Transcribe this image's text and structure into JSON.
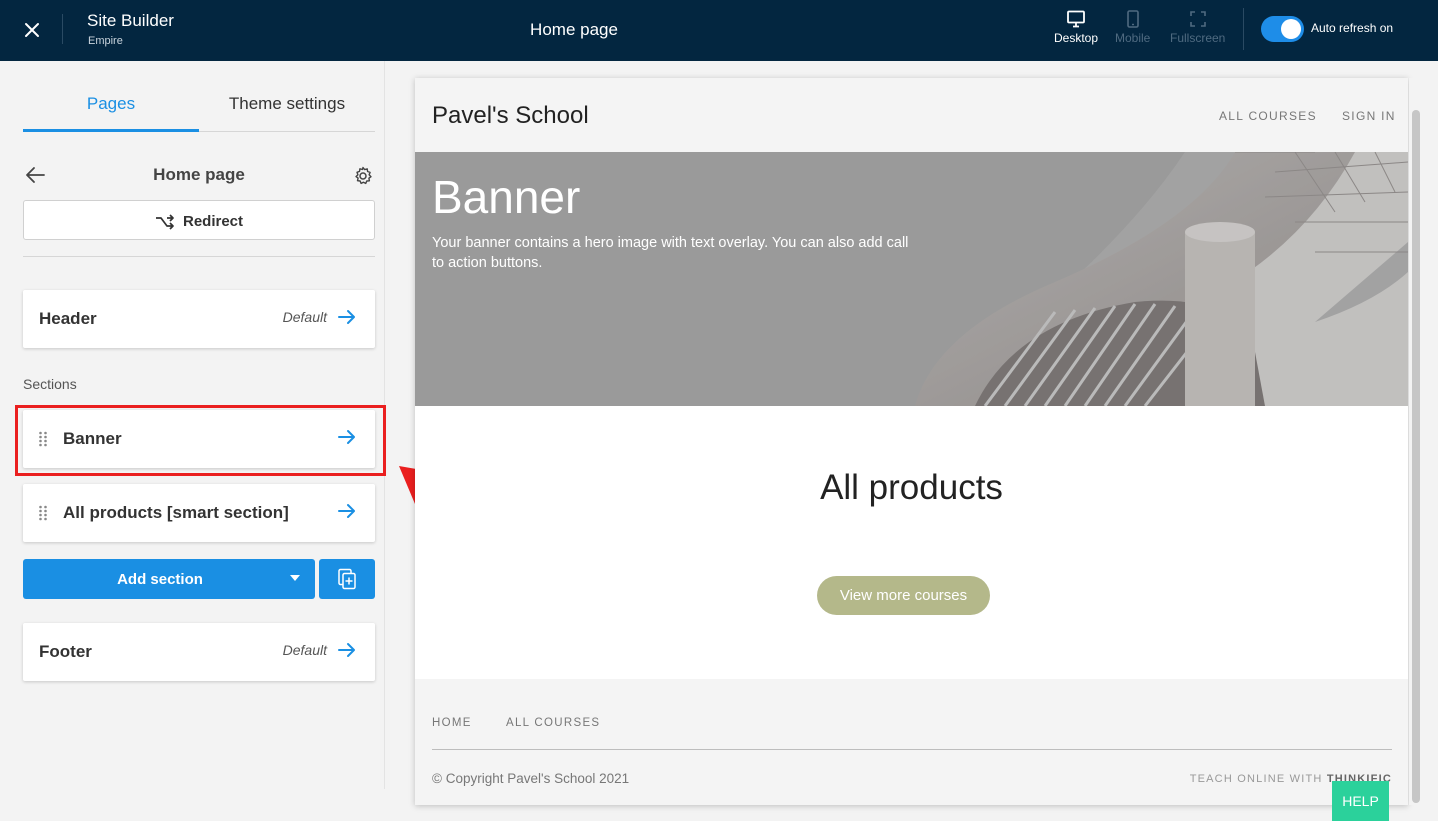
{
  "topbar": {
    "title": "Site Builder",
    "subtitle": "Empire",
    "page_name": "Home page",
    "devices": [
      {
        "label": "Desktop",
        "state": "active",
        "icon": "desktop-icon"
      },
      {
        "label": "Mobile",
        "state": "disabled",
        "icon": "mobile-icon"
      },
      {
        "label": "Fullscreen",
        "state": "disabled",
        "icon": "fullscreen-icon"
      }
    ],
    "auto_refresh_label": "Auto refresh on",
    "auto_refresh_on": true
  },
  "sidebar": {
    "tabs": [
      {
        "label": "Pages",
        "active": true
      },
      {
        "label": "Theme settings",
        "active": false
      }
    ],
    "page_heading": "Home page",
    "redirect_label": "Redirect",
    "header_card": {
      "label": "Header",
      "status": "Default"
    },
    "sections_label": "Sections",
    "sections": [
      {
        "label": "Banner"
      },
      {
        "label": "All products [smart section]"
      }
    ],
    "add_section_label": "Add section",
    "footer_card": {
      "label": "Footer",
      "status": "Default"
    }
  },
  "preview": {
    "brand": "Pavel's School",
    "nav": [
      "ALL COURSES",
      "SIGN IN"
    ],
    "banner_title": "Banner",
    "banner_text": "Your banner contains a hero image with text overlay. You can also add call to action buttons.",
    "products_title": "All products",
    "more_button": "View more courses",
    "footer_nav": [
      "HOME",
      "ALL COURSES"
    ],
    "copyright": "© Copyright Pavel's School 2021",
    "teach_prefix": "TEACH ONLINE WITH",
    "teach_brand": "THINKIFIC"
  },
  "help_label": "HELP",
  "colors": {
    "topbar": "#032640",
    "accent": "#1a8fe3",
    "annotation": "#ea1f1f",
    "more_button": "#b4b88a",
    "help": "#2bd19b"
  }
}
